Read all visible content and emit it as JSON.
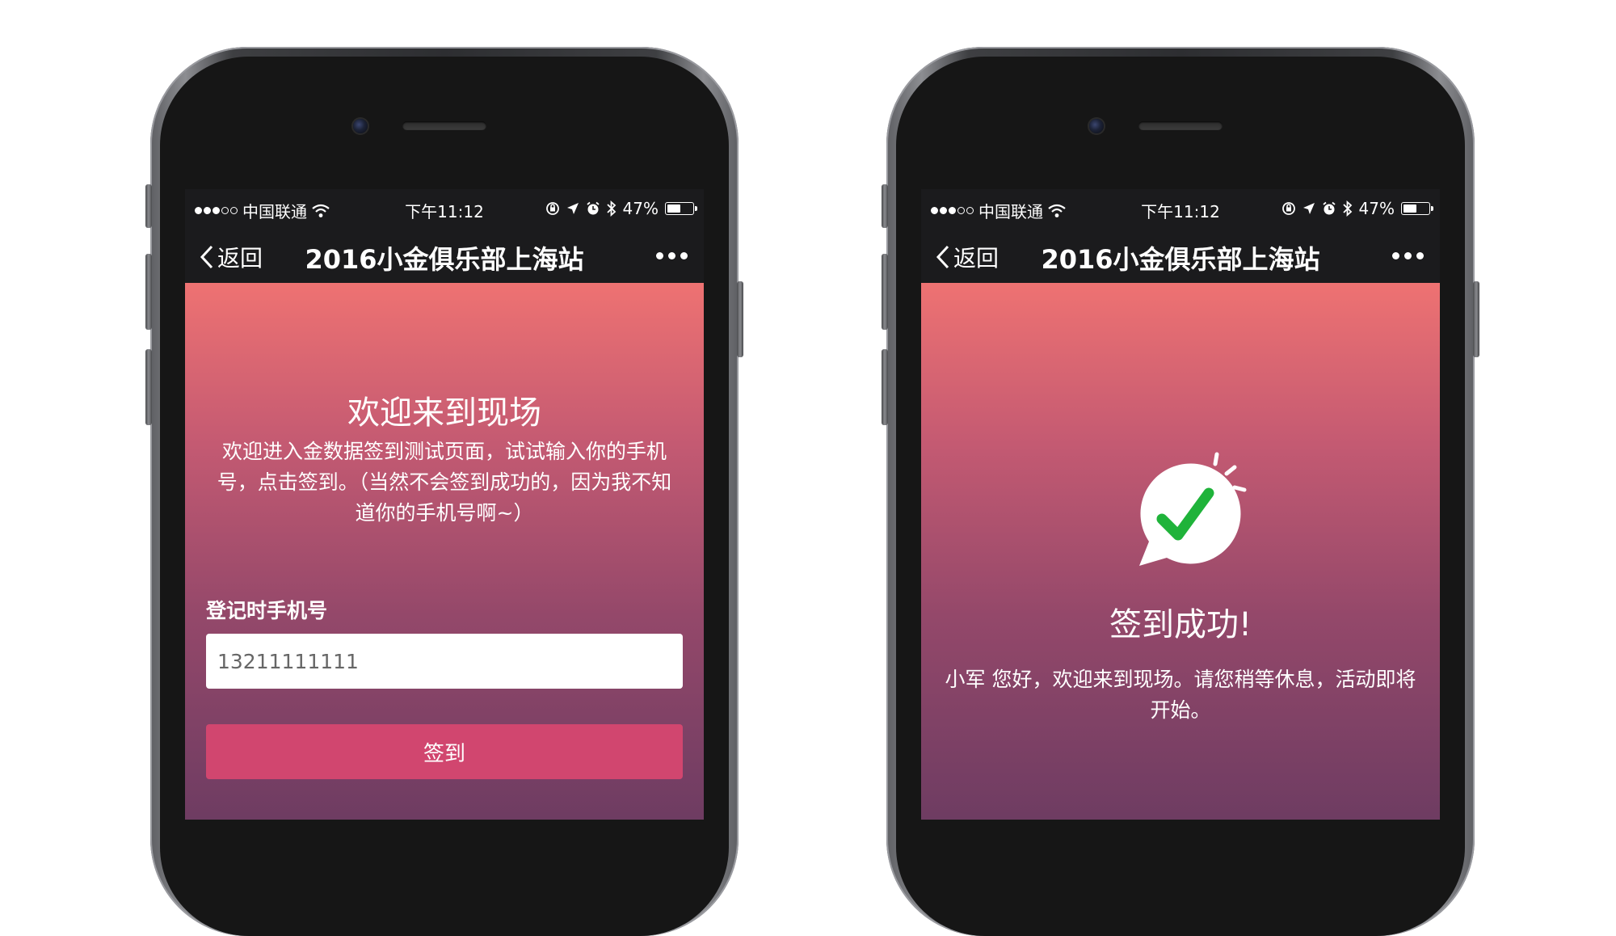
{
  "status_bar": {
    "carrier": "中国联通",
    "time": "下午11:12",
    "battery": "47%",
    "battery_level": 0.47
  },
  "nav": {
    "back_label": "返回",
    "title": "2016小金俱乐部上海站"
  },
  "signin_screen": {
    "heading": "欢迎来到现场",
    "description": "欢迎进入金数据签到测试页面，试试输入你的手机号，点击签到。（当然不会签到成功的，因为我不知道你的手机号啊~）",
    "phone_label": "登记时手机号",
    "phone_value": "13211111111",
    "submit_label": "签到"
  },
  "success_screen": {
    "heading": "签到成功!",
    "message": "小军 您好，欢迎来到现场。请您稍等休息，活动即将开始。"
  },
  "colors": {
    "gradient_top": "#ee7272",
    "gradient_bottom": "#6e3c62",
    "button": "#d1466f",
    "check_green": "#1fb33a"
  },
  "icons": [
    "wifi-icon",
    "orientation-lock-icon",
    "location-icon",
    "alarm-icon",
    "bluetooth-icon",
    "battery-icon",
    "chevron-left-icon",
    "more-icon",
    "success-check-icon"
  ]
}
